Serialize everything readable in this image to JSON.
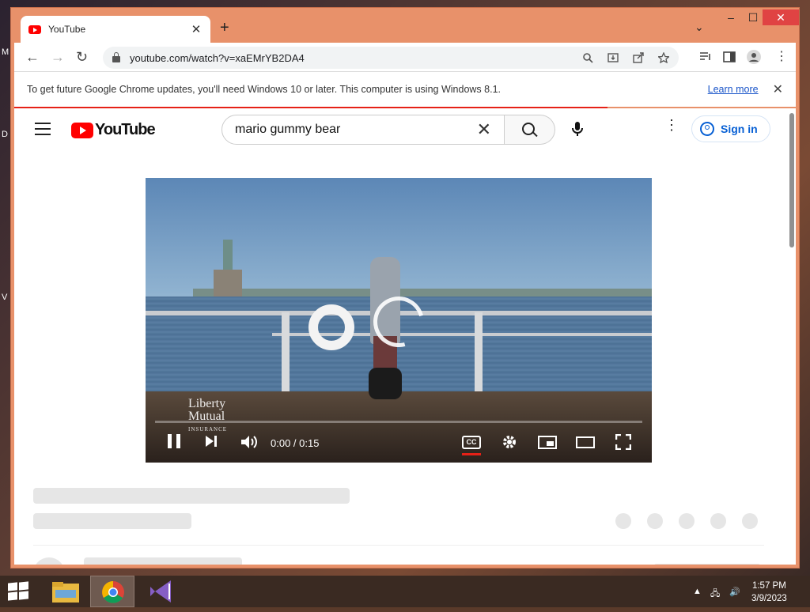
{
  "window": {
    "tab_title": "YouTube",
    "tab_close": "✕",
    "new_tab": "+",
    "tab_search": "⌄",
    "minimize": "–",
    "maximize": "☐",
    "close": "✕"
  },
  "toolbar": {
    "back": "←",
    "forward": "→",
    "reload": "↻",
    "url": "youtube.com/watch?v=xaEMrYB2DA4",
    "icons": [
      "search-icon",
      "install-icon",
      "share-icon",
      "bookmark-star-icon",
      "reading-list-icon",
      "side-panel-icon",
      "profile-icon",
      "menu-icon"
    ]
  },
  "infobar": {
    "message": "To get future Google Chrome updates, you'll need Windows 10 or later. This computer is using Windows 8.1.",
    "learn_more": "Learn more",
    "close": "✕"
  },
  "youtube": {
    "logo_text": "YouTube",
    "search_value": "mario gummy bear",
    "clear": "✕",
    "kebab": "⋮",
    "sign_in": "Sign in"
  },
  "player": {
    "brand_line1": "Liberty",
    "brand_line2": "Mutual",
    "brand_sub": "INSURANCE",
    "time": "0:00 / 0:15",
    "cc": "CC",
    "progress": 0
  },
  "taskbar": {
    "apps": [
      "start-icon",
      "file-explorer-icon",
      "chrome-icon",
      "visual-studio-icon"
    ],
    "time": "1:57 PM",
    "date": "3/9/2023"
  },
  "colors": {
    "window_frame": "#e8916a",
    "youtube_red": "#ff0000",
    "link_blue": "#065fd4",
    "load_bar": "#e62117"
  }
}
